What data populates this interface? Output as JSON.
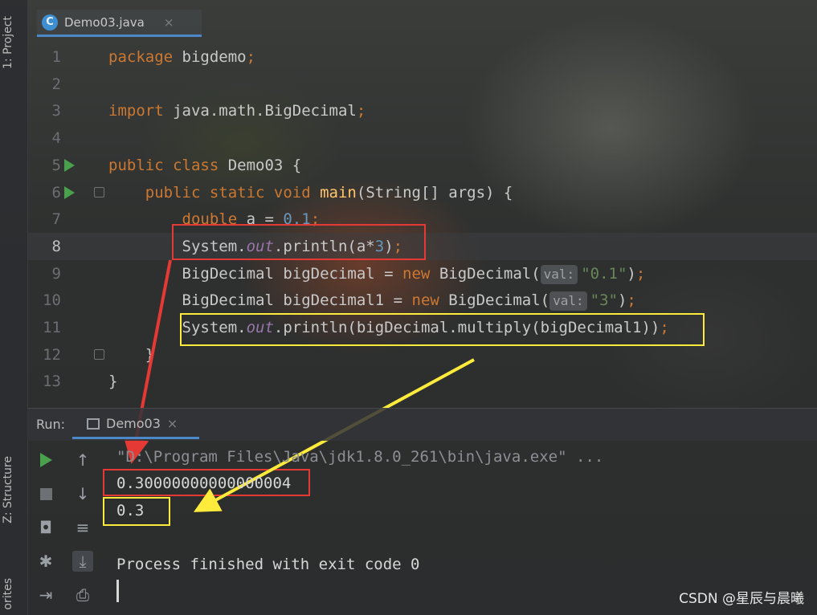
{
  "tool_window_tabs": {
    "project": "1: Project",
    "structure": "Z: Structure",
    "favorites": "orites"
  },
  "editor_tab": {
    "icon_letter": "C",
    "filename": "Demo03.java",
    "close": "×"
  },
  "code_lines": [
    {
      "num": "1",
      "tokens": [
        [
          "kw",
          "package "
        ],
        [
          "plain",
          "bigdemo"
        ],
        [
          "kw",
          ";"
        ]
      ]
    },
    {
      "num": "2",
      "tokens": []
    },
    {
      "num": "3",
      "tokens": [
        [
          "kw",
          "import "
        ],
        [
          "plain",
          "java.math.BigDecimal"
        ],
        [
          "kw",
          ";"
        ]
      ]
    },
    {
      "num": "4",
      "tokens": []
    },
    {
      "num": "5",
      "tokens": [
        [
          "kw",
          "public class "
        ],
        [
          "plain",
          "Demo03 {"
        ]
      ]
    },
    {
      "num": "6",
      "tokens": [
        [
          "plain",
          "    "
        ],
        [
          "kw",
          "public static void "
        ],
        [
          "fn",
          "main"
        ],
        [
          "plain",
          "(String[] args) {"
        ]
      ]
    },
    {
      "num": "7",
      "tokens": [
        [
          "plain",
          "        "
        ],
        [
          "kw",
          "double "
        ],
        [
          "plain",
          "a = "
        ],
        [
          "num",
          "0.1"
        ],
        [
          "kw",
          ";"
        ]
      ]
    },
    {
      "num": "8",
      "tokens": [
        [
          "plain",
          "        System."
        ],
        [
          "field",
          "out"
        ],
        [
          "plain",
          ".println(a*"
        ],
        [
          "num",
          "3"
        ],
        [
          "plain",
          ")"
        ],
        [
          "kw",
          ";"
        ]
      ]
    },
    {
      "num": "9",
      "tokens": [
        [
          "plain",
          "        BigDecimal bigDecimal = "
        ],
        [
          "kw",
          "new "
        ],
        [
          "plain",
          "BigDecimal("
        ],
        [
          "hint",
          "val:"
        ],
        [
          "str",
          "\"0.1\""
        ],
        [
          "plain",
          ")"
        ],
        [
          "kw",
          ";"
        ]
      ]
    },
    {
      "num": "10",
      "tokens": [
        [
          "plain",
          "        BigDecimal bigDecimal1 = "
        ],
        [
          "kw",
          "new "
        ],
        [
          "plain",
          "BigDecimal("
        ],
        [
          "hint",
          "val:"
        ],
        [
          "str",
          "\"3\""
        ],
        [
          "plain",
          ")"
        ],
        [
          "kw",
          ";"
        ]
      ]
    },
    {
      "num": "11",
      "tokens": [
        [
          "plain",
          "        System."
        ],
        [
          "field",
          "out"
        ],
        [
          "plain",
          ".println(bigDecimal.multiply(bigDecimal1))"
        ],
        [
          "kw",
          ";"
        ]
      ]
    },
    {
      "num": "12",
      "tokens": [
        [
          "plain",
          "    }"
        ]
      ]
    },
    {
      "num": "13",
      "tokens": [
        [
          "plain",
          "}"
        ]
      ]
    }
  ],
  "run_panel": {
    "label": "Run:",
    "tab_name": "Demo03",
    "tab_close": "×"
  },
  "console_lines": {
    "command": "\"D:\\Program Files\\Java\\jdk1.8.0_261\\bin\\java.exe\" ...",
    "out1": "0.30000000000000004",
    "out2": "0.3",
    "blank": "",
    "finished": "Process finished with exit code 0"
  },
  "watermark": "CSDN @星辰与晨曦",
  "colors": {
    "keyword": "#cc7832",
    "method": "#ffc66d",
    "number": "#6897bb",
    "string": "#6a8759",
    "field": "#9876aa",
    "red_annotation": "#e53935",
    "yellow_annotation": "#ffeb3b"
  }
}
